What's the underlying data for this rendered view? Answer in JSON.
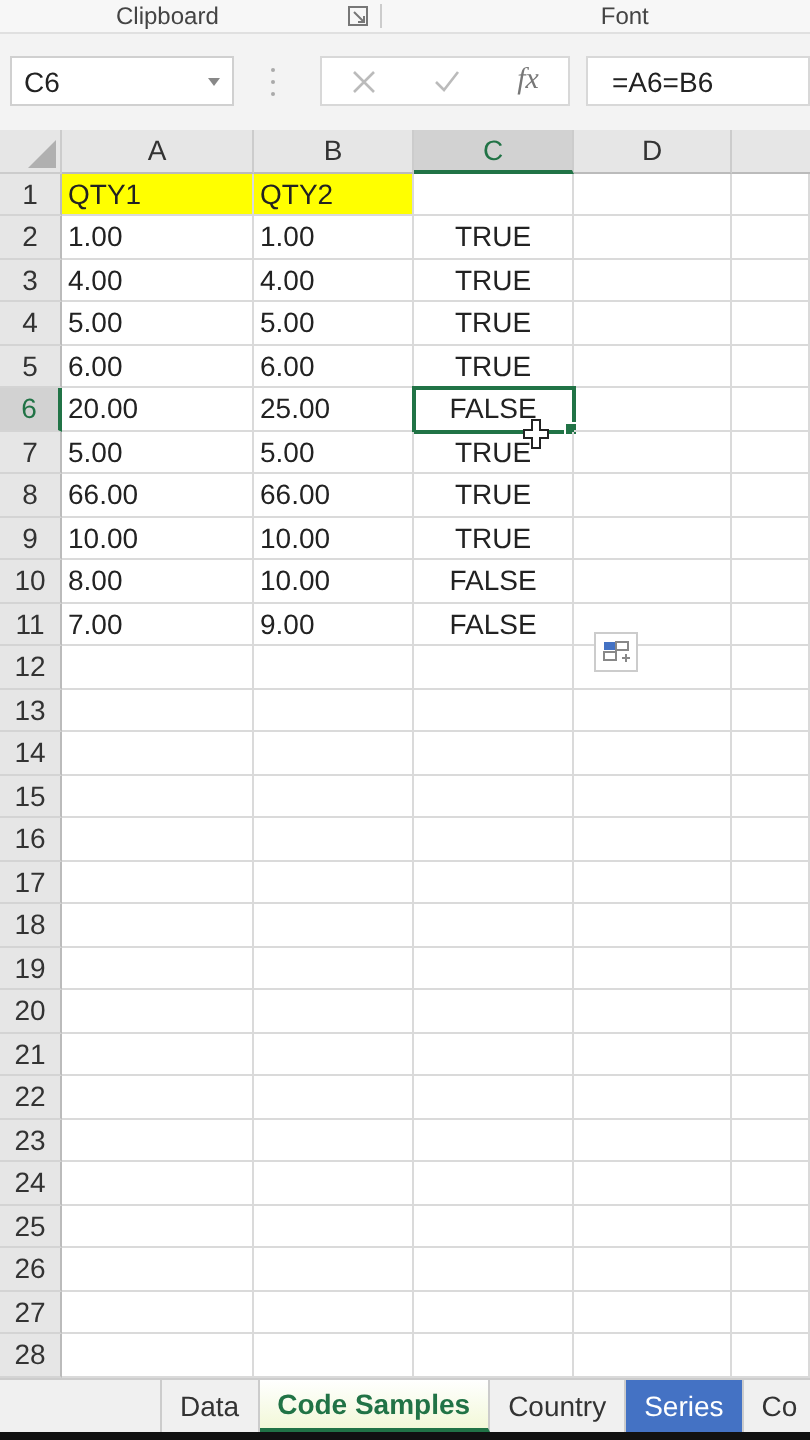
{
  "ribbon": {
    "groups": [
      "Clipboard",
      "Font"
    ]
  },
  "formula_bar": {
    "name_box": "C6",
    "fx": "fx",
    "formula": "=A6=B6"
  },
  "columns": [
    {
      "label": "A",
      "selected": false
    },
    {
      "label": "B",
      "selected": false
    },
    {
      "label": "C",
      "selected": true
    },
    {
      "label": "D",
      "selected": false
    }
  ],
  "rows": [
    {
      "number": "1",
      "selected": false,
      "cells": [
        {
          "text": "QTY1",
          "highlighted": true,
          "selected": false
        },
        {
          "text": "QTY2",
          "highlighted": true,
          "selected": false
        },
        {
          "text": "",
          "highlighted": false,
          "selected": false
        }
      ]
    },
    {
      "number": "2",
      "selected": false,
      "cells": [
        {
          "text": "1.00",
          "highlighted": false,
          "selected": false
        },
        {
          "text": "1.00",
          "highlighted": false,
          "selected": false
        },
        {
          "text": "TRUE",
          "highlighted": false,
          "selected": false
        }
      ]
    },
    {
      "number": "3",
      "selected": false,
      "cells": [
        {
          "text": "4.00",
          "highlighted": false,
          "selected": false
        },
        {
          "text": "4.00",
          "highlighted": false,
          "selected": false
        },
        {
          "text": "TRUE",
          "highlighted": false,
          "selected": false
        }
      ]
    },
    {
      "number": "4",
      "selected": false,
      "cells": [
        {
          "text": "5.00",
          "highlighted": false,
          "selected": false
        },
        {
          "text": "5.00",
          "highlighted": false,
          "selected": false
        },
        {
          "text": "TRUE",
          "highlighted": false,
          "selected": false
        }
      ]
    },
    {
      "number": "5",
      "selected": false,
      "cells": [
        {
          "text": "6.00",
          "highlighted": false,
          "selected": false
        },
        {
          "text": "6.00",
          "highlighted": false,
          "selected": false
        },
        {
          "text": "TRUE",
          "highlighted": false,
          "selected": false
        }
      ]
    },
    {
      "number": "6",
      "selected": true,
      "cells": [
        {
          "text": "20.00",
          "highlighted": false,
          "selected": false
        },
        {
          "text": "25.00",
          "highlighted": false,
          "selected": false
        },
        {
          "text": "FALSE",
          "highlighted": false,
          "selected": true
        }
      ]
    },
    {
      "number": "7",
      "selected": false,
      "cells": [
        {
          "text": "5.00",
          "highlighted": false,
          "selected": false
        },
        {
          "text": "5.00",
          "highlighted": false,
          "selected": false
        },
        {
          "text": "TRUE",
          "highlighted": false,
          "selected": false
        }
      ]
    },
    {
      "number": "8",
      "selected": false,
      "cells": [
        {
          "text": "66.00",
          "highlighted": false,
          "selected": false
        },
        {
          "text": "66.00",
          "highlighted": false,
          "selected": false
        },
        {
          "text": "TRUE",
          "highlighted": false,
          "selected": false
        }
      ]
    },
    {
      "number": "9",
      "selected": false,
      "cells": [
        {
          "text": "10.00",
          "highlighted": false,
          "selected": false
        },
        {
          "text": "10.00",
          "highlighted": false,
          "selected": false
        },
        {
          "text": "TRUE",
          "highlighted": false,
          "selected": false
        }
      ]
    },
    {
      "number": "10",
      "selected": false,
      "cells": [
        {
          "text": "8.00",
          "highlighted": false,
          "selected": false
        },
        {
          "text": "10.00",
          "highlighted": false,
          "selected": false
        },
        {
          "text": "FALSE",
          "highlighted": false,
          "selected": false
        }
      ]
    },
    {
      "number": "11",
      "selected": false,
      "cells": [
        {
          "text": "7.00",
          "highlighted": false,
          "selected": false
        },
        {
          "text": "9.00",
          "highlighted": false,
          "selected": false
        },
        {
          "text": "FALSE",
          "highlighted": false,
          "selected": false
        }
      ]
    },
    {
      "number": "12",
      "selected": false
    },
    {
      "number": "13",
      "selected": false
    },
    {
      "number": "14",
      "selected": false
    },
    {
      "number": "15",
      "selected": false
    },
    {
      "number": "16",
      "selected": false
    },
    {
      "number": "17",
      "selected": false
    },
    {
      "number": "18",
      "selected": false
    },
    {
      "number": "19",
      "selected": false
    },
    {
      "number": "20",
      "selected": false
    },
    {
      "number": "21",
      "selected": false
    },
    {
      "number": "22",
      "selected": false
    },
    {
      "number": "23",
      "selected": false
    },
    {
      "number": "24",
      "selected": false
    },
    {
      "number": "25",
      "selected": false
    },
    {
      "number": "26",
      "selected": false
    },
    {
      "number": "27",
      "selected": false
    },
    {
      "number": "28",
      "selected": false
    }
  ],
  "sheet_tabs": [
    {
      "label": "Data",
      "selected": false
    },
    {
      "label": "Code Samples",
      "selected": true
    },
    {
      "label": "Country",
      "selected": false
    },
    {
      "label": "Series",
      "selected": false,
      "color": "#4472c4"
    },
    {
      "label": "Co",
      "selected": false
    }
  ]
}
